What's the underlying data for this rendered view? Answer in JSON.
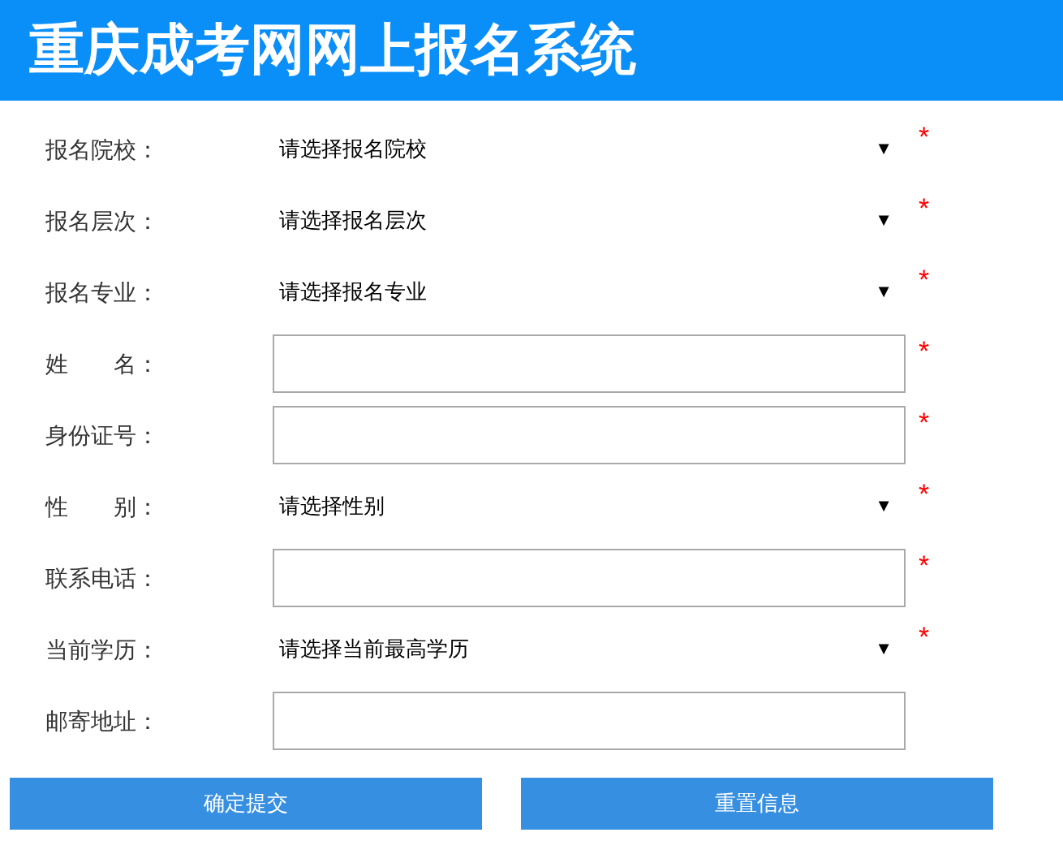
{
  "header": {
    "title": "重庆成考网网上报名系统"
  },
  "fields": [
    {
      "kind": "select",
      "label": "报名院校：",
      "value": "请选择报名院校",
      "arrow": "▼",
      "required_mark": "*"
    },
    {
      "kind": "select",
      "label": "报名层次：",
      "value": "请选择报名层次",
      "arrow": "▼",
      "required_mark": "*"
    },
    {
      "kind": "select",
      "label": "报名专业：",
      "value": "请选择报名专业",
      "arrow": "▼",
      "required_mark": "*"
    },
    {
      "kind": "input",
      "label": "姓　　名：",
      "required_mark": "*"
    },
    {
      "kind": "input",
      "label": "身份证号：",
      "required_mark": "*"
    },
    {
      "kind": "select",
      "label": "性　　别：",
      "value": "请选择性别",
      "arrow": "▼",
      "required_mark": "*"
    },
    {
      "kind": "input",
      "label": "联系电话：",
      "required_mark": "*"
    },
    {
      "kind": "select",
      "label": "当前学历：",
      "value": "请选择当前最高学历",
      "arrow": "▼",
      "required_mark": "*"
    },
    {
      "kind": "input",
      "label": "邮寄地址："
    }
  ],
  "buttons": [
    "确定提交",
    "重置信息"
  ]
}
